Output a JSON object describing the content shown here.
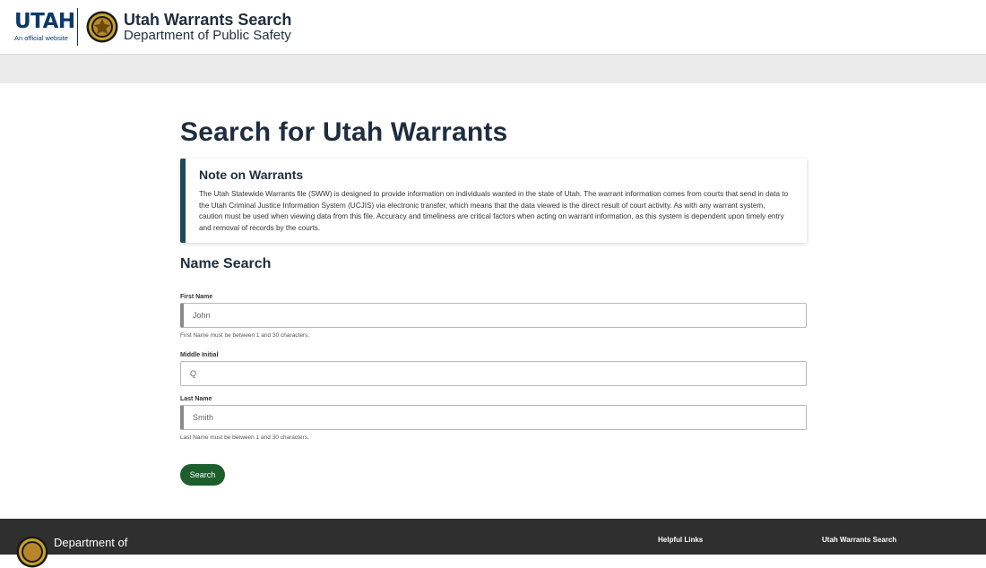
{
  "header": {
    "utah_wordmark": "UTAH",
    "utah_tagline": "An official website",
    "app_title": "Utah Warrants Search",
    "app_subtitle": "Department of Public Safety"
  },
  "main": {
    "page_title": "Search for Utah Warrants",
    "note": {
      "title": "Note on Warrants",
      "body": "The Utah Statewide Warrants file (SWW) is designed to provide information on individuals wanted in the state of Utah. The warrant information comes from courts that send in data to the Utah Criminal Justice Information System (UCJIS) via electronic transfer, which means that the data viewed is the direct result of court activity. As with any warrant system, caution must be used when viewing data from this file. Accuracy and timeliness are critical factors when acting on warrant information, as this system is dependent upon timely entry and removal of records by the courts."
    },
    "section_title": "Name Search",
    "first_name": {
      "label": "First Name",
      "placeholder": "John",
      "hint": "First Name must be between 1 and 30 characters."
    },
    "middle_initial": {
      "label": "Middle Initial",
      "placeholder": "Q"
    },
    "last_name": {
      "label": "Last Name",
      "placeholder": "Smith",
      "hint": "Last Name must be between 1 and 30 characters."
    },
    "search_button": "Search"
  },
  "footer": {
    "dept_label": "Department of",
    "helpful_links": "Helpful Links",
    "utah_warrants_search": "Utah Warrants Search"
  },
  "colors": {
    "brand_navy": "#0d3a6b",
    "note_accent": "#1f4a5e",
    "button_green": "#1c5e2c",
    "footer_bg": "#2f2f2f",
    "band_gray": "#ebebeb"
  },
  "icons": [
    "utah-logo",
    "dps-seal-icon"
  ]
}
